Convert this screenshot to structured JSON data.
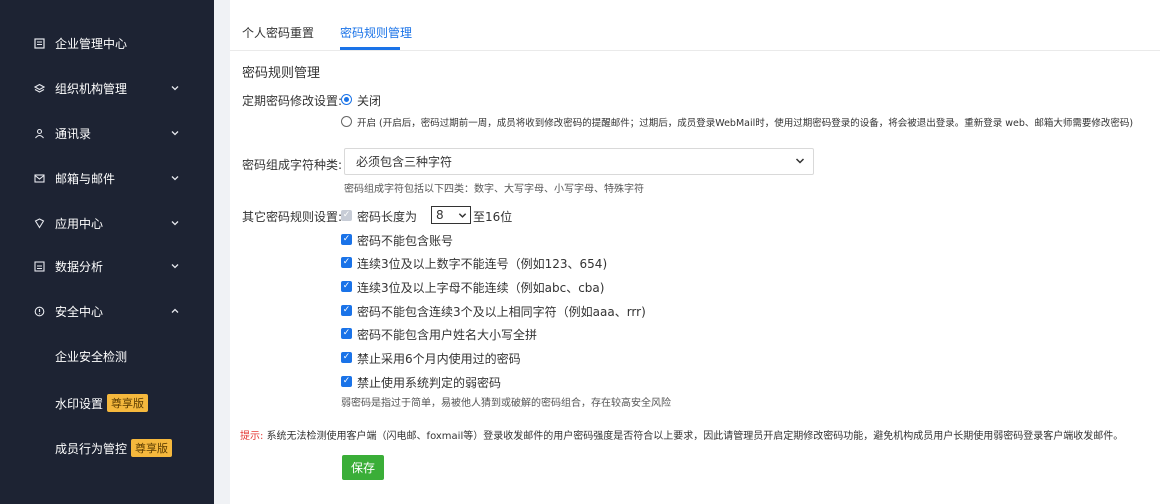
{
  "sidebar": {
    "items": [
      {
        "label": "企业管理中心",
        "icon": "document-icon",
        "arrow": ""
      },
      {
        "label": "组织机构管理",
        "icon": "layers-icon",
        "arrow": "down"
      },
      {
        "label": "通讯录",
        "icon": "contacts-icon",
        "arrow": "down"
      },
      {
        "label": "邮箱与邮件",
        "icon": "mail-icon",
        "arrow": "down"
      },
      {
        "label": "应用中心",
        "icon": "app-icon",
        "arrow": "down"
      },
      {
        "label": "数据分析",
        "icon": "chart-icon",
        "arrow": "down"
      },
      {
        "label": "安全中心",
        "icon": "shield-icon",
        "arrow": "up"
      }
    ],
    "sub_items": [
      {
        "label": "企业安全检测",
        "badge": ""
      },
      {
        "label": "水印设置",
        "badge": "尊享版"
      },
      {
        "label": "成员行为管控",
        "badge": "尊享版"
      }
    ]
  },
  "tabs": [
    {
      "label": "个人密码重置",
      "active": false
    },
    {
      "label": "密码规则管理",
      "active": true
    }
  ],
  "section_title": "密码规则管理",
  "expiry": {
    "label": "定期密码修改设置:",
    "option_off": "关闭",
    "option_on": "开启 (开启后，密码过期前一周，成员将收到修改密码的提醒邮件；过期后，成员登录WebMail时，使用过期密码登录的设备，将会被退出登录。重新登录 web、邮箱大师需要修改密码)",
    "selected": "off"
  },
  "composition": {
    "label": "密码组成字符种类:",
    "selected": "必须包含三种字符",
    "hint": "密码组成字符包括以下四类：数字、大写字母、小写字母、特殊字符"
  },
  "other_rules": {
    "label": "其它密码规则设置:",
    "length_prefix": "密码长度为",
    "length_value": "8",
    "length_suffix": "至16位",
    "rules": [
      {
        "text": "密码不能包含账号",
        "checked": true
      },
      {
        "text": "连续3位及以上数字不能连号（例如123、654)",
        "checked": true
      },
      {
        "text": "连续3位及以上字母不能连续（例如abc、cba)",
        "checked": true
      },
      {
        "text": "密码不能包含连续3个及以上相同字符（例如aaa、rrr)",
        "checked": true
      },
      {
        "text": "密码不能包含用户姓名大小写全拼",
        "checked": true
      },
      {
        "text": "禁止采用6个月内使用过的密码",
        "checked": true
      },
      {
        "text": "禁止使用系统判定的弱密码",
        "checked": true
      }
    ],
    "weak_hint": "弱密码是指过于简单，易被他人猜到或破解的密码组合，存在较高安全风险"
  },
  "tip": {
    "prefix": "提示:",
    "text": "系统无法检测使用客户端（闪电邮、foxmail等）登录收发邮件的用户密码强度是否符合以上要求，因此请管理员开启定期修改密码功能，避免机构成员用户长期使用弱密码登录客户端收发邮件。"
  },
  "save_label": "保存",
  "colors": {
    "sidebar_bg": "#1d2333",
    "accent": "#1a73e8",
    "save": "#3aae38",
    "badge": "#f5b83d",
    "tip": "#e53935"
  }
}
